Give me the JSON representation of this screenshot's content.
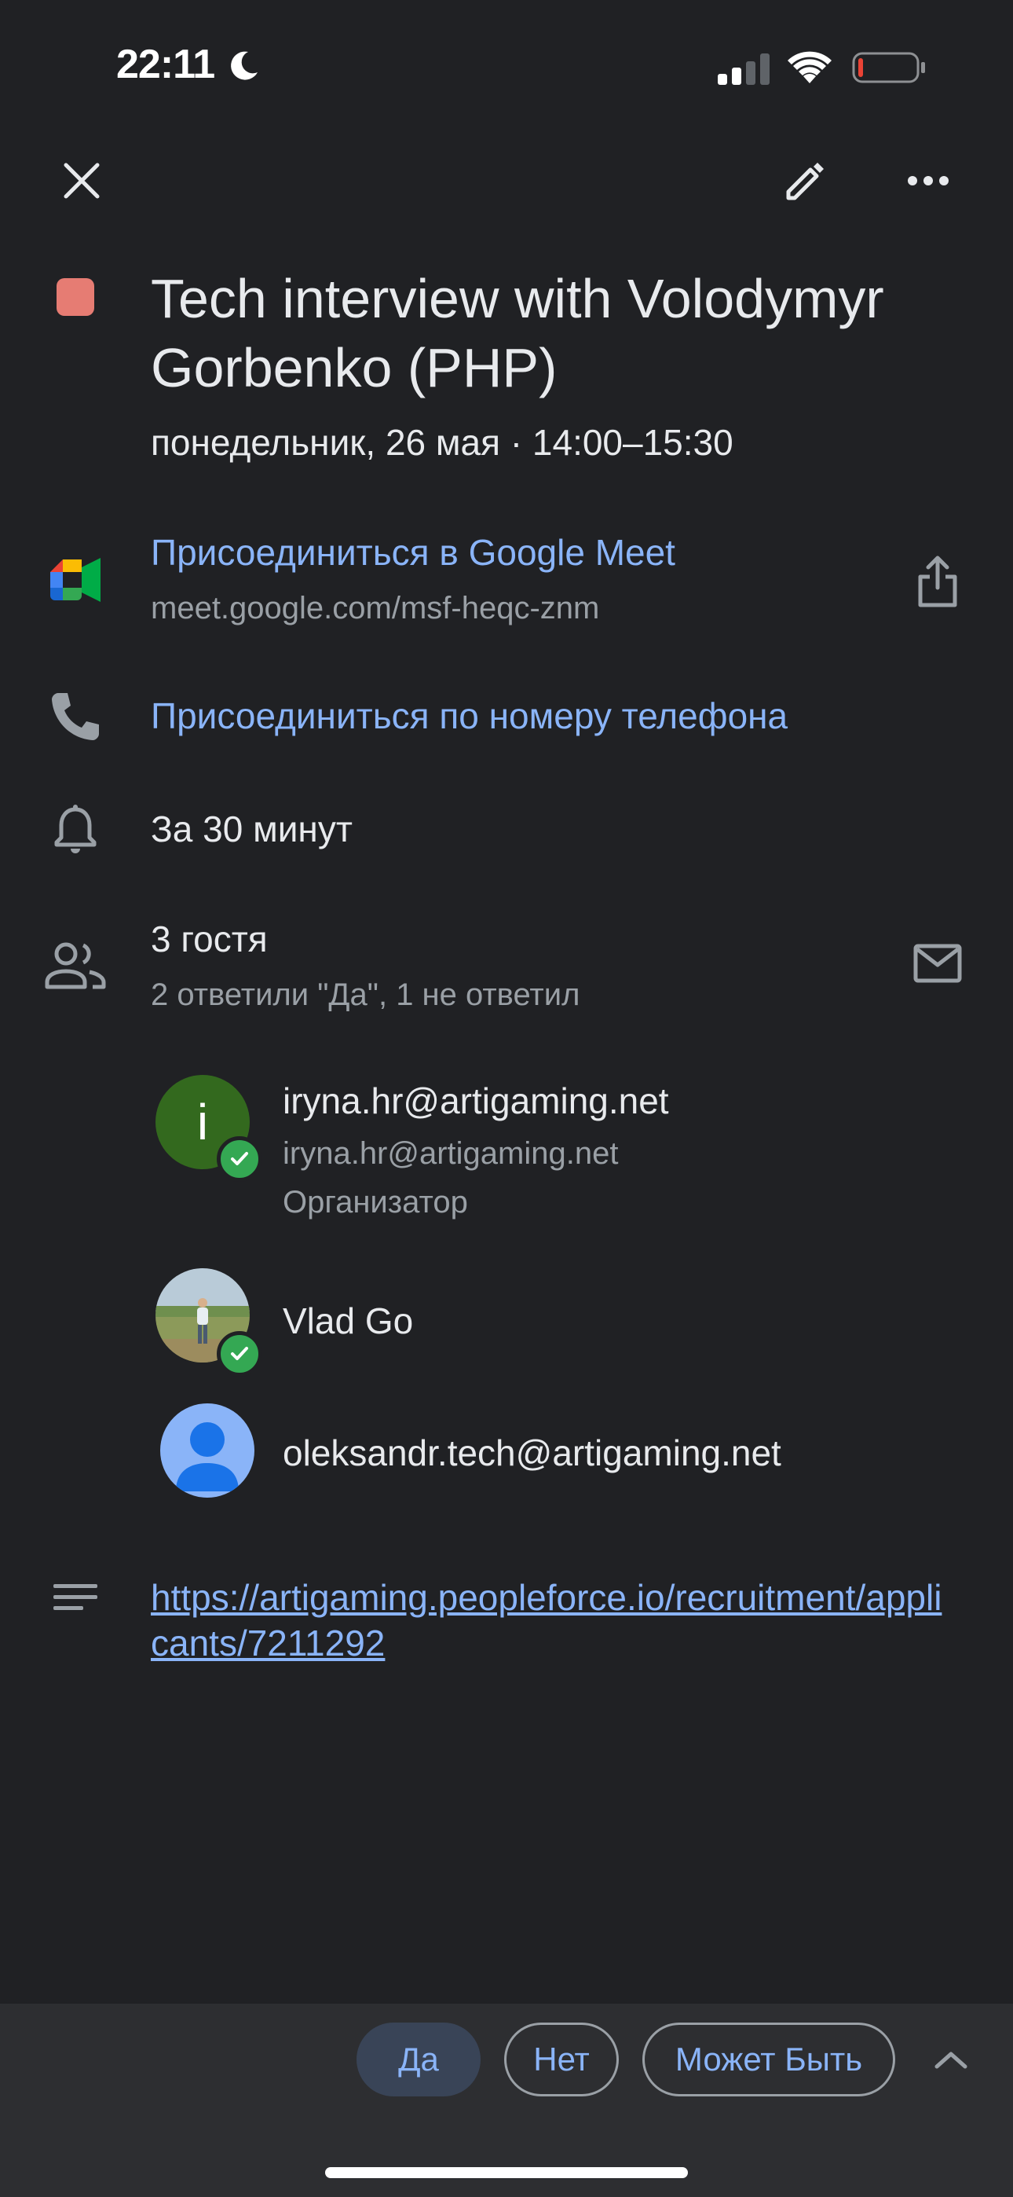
{
  "status_bar": {
    "time": "22:11"
  },
  "event": {
    "title": "Tech interview with Volodymyr Gorbenko (PHP)",
    "datetime": "понедельник, 26 мая · 14:00–15:30",
    "color": "#e67c73"
  },
  "meet": {
    "join_label": "Присоединиться в Google Meet",
    "url": "meet.google.com/msf-heqc-znm"
  },
  "phone": {
    "join_label": "Присоединиться по номеру телефона"
  },
  "reminder": {
    "label": "За 30 минут"
  },
  "guests": {
    "title": "3 гостя",
    "summary": "2 ответили \"Да\", 1 не ответил",
    "list": [
      {
        "name": "iryna.hr@artigaming.net",
        "email": "iryna.hr@artigaming.net",
        "role": "Организатор",
        "initial": "i",
        "accepted": true
      },
      {
        "name": "Vlad Go",
        "accepted": true
      },
      {
        "name": "oleksandr.tech@artigaming.net",
        "accepted": false
      }
    ]
  },
  "description": {
    "link": "https://artigaming.peopleforce.io/recruitment/applicants/7211292"
  },
  "rsvp": {
    "yes": "Да",
    "no": "Нет",
    "maybe": "Может Быть",
    "selected": "yes"
  },
  "colors": {
    "background": "#202124",
    "link": "#8ab4f8",
    "secondary_text": "#9aa0a6",
    "bottom_bar": "#2d2e31",
    "accepted_check": "#34a853"
  }
}
